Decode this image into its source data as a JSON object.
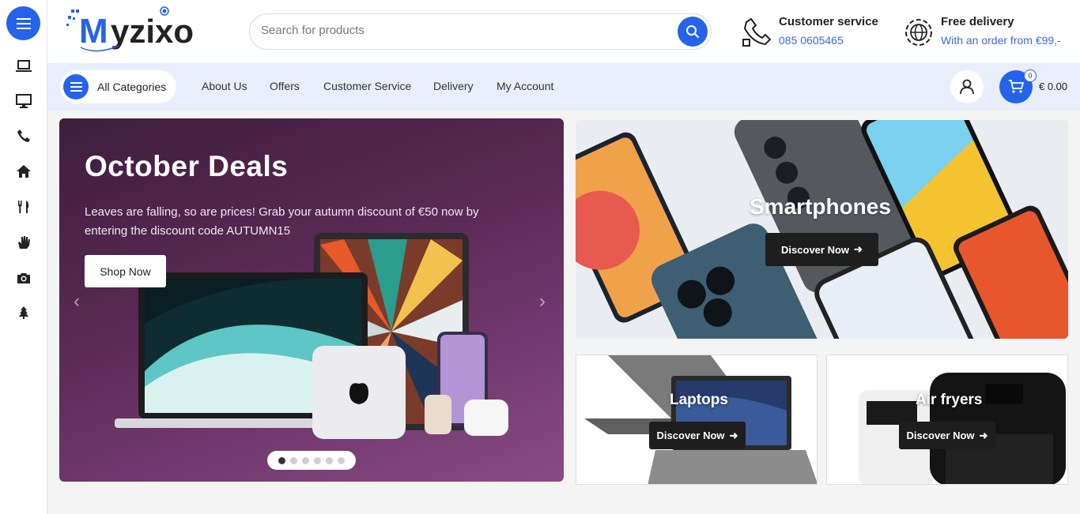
{
  "brand": {
    "name": "Myzixo",
    "accent": "#2563eb"
  },
  "sidebar": {
    "icons": [
      "laptop-icon",
      "monitor-icon",
      "phone-icon",
      "home-icon",
      "cutlery-icon",
      "hand-icon",
      "camera-icon",
      "tree-icon"
    ]
  },
  "search": {
    "placeholder": "Search for products"
  },
  "customer_service": {
    "title": "Customer service",
    "phone": "085 0605465"
  },
  "delivery": {
    "title": "Free delivery",
    "subtitle": "With an order from €99,-"
  },
  "nav": {
    "all_categories": "All Categories",
    "links": [
      "About Us",
      "Offers",
      "Customer Service",
      "Delivery",
      "My Account"
    ]
  },
  "cart": {
    "count": "0",
    "total": "€ 0.00"
  },
  "hero": {
    "title": "October Deals",
    "text": "Leaves are falling, so are prices! Grab your autumn discount of €50 now by entering the discount code AUTUMN15",
    "button": "Shop Now",
    "slides": 6,
    "active_slide": 1
  },
  "promos": {
    "smartphones": {
      "title": "Smartphones",
      "button": "Discover Now"
    },
    "laptops": {
      "title": "Laptops",
      "button": "Discover Now"
    },
    "airfryers": {
      "title": "Air fryers",
      "button": "Discover Now"
    }
  }
}
